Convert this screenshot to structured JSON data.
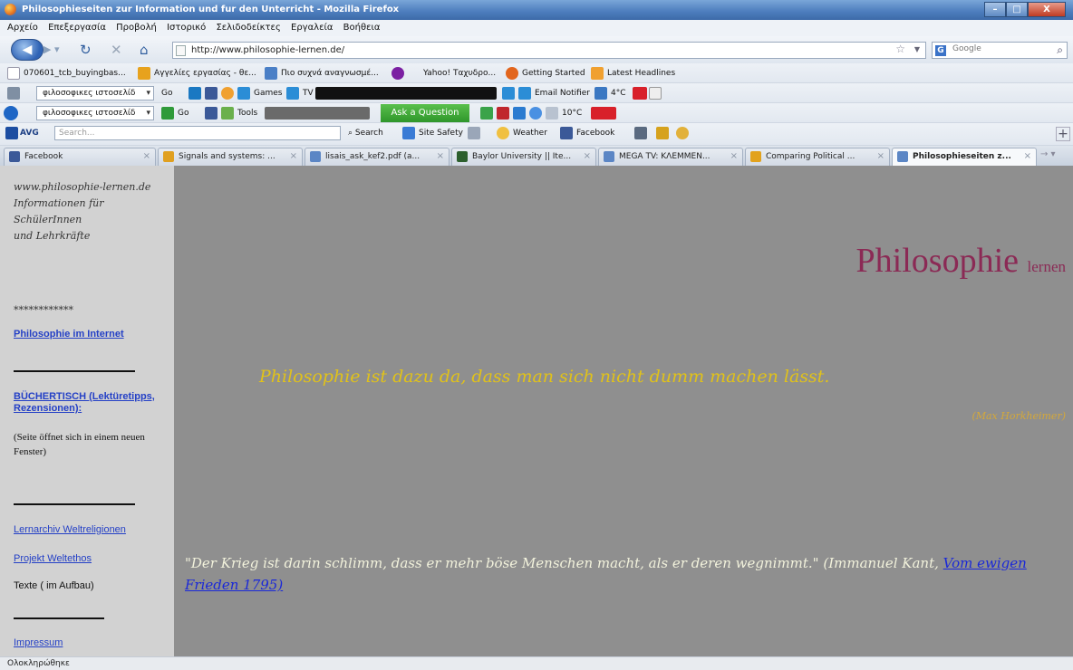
{
  "window": {
    "title": "Philosophieseiten zur Information und fur den Unterricht - Mozilla Firefox",
    "min": "–",
    "max": "□",
    "close": "X"
  },
  "menu": [
    "Αρχείο",
    "Επεξεργασία",
    "Προβολή",
    "Ιστορικό",
    "Σελιδοδείκτες",
    "Εργαλεία",
    "Βοήθεια"
  ],
  "nav": {
    "url": "http://www.philosophie-lernen.de/",
    "search_placeholder": "Google"
  },
  "bookmarks": {
    "items": [
      "070601_tcb_buyingbas...",
      "Αγγελίες εργασίας - θε...",
      "Πιο συχνά αναγνωσμέ...",
      "Yahoo! Ταχυδρο...",
      "Getting Started",
      "Latest Headlines"
    ]
  },
  "toolbar1": {
    "select": "φιλοσοφικες ιστοσελίδ",
    "go": "Go",
    "games": "Games",
    "tv": "TV",
    "email": "Email Notifier",
    "temp": "4°C"
  },
  "toolbar2": {
    "select": "φιλοσοφικες ιστοσελίδ",
    "go": "Go",
    "tools": "Tools",
    "ask": "Ask a Question",
    "temp": "10°C"
  },
  "avg": {
    "logo": "AVG",
    "placeholder": "Search...",
    "search": "Search",
    "safety": "Site Safety",
    "weather": "Weather",
    "facebook": "Facebook"
  },
  "tabs": [
    {
      "label": "Facebook",
      "color": "#3b5998"
    },
    {
      "label": "Signals and systems: ...",
      "color": "#e0a020"
    },
    {
      "label": "lisais_ask_kef2.pdf (a...",
      "color": "#5b86c5"
    },
    {
      "label": "Baylor University || Ite...",
      "color": "#2c5f2d"
    },
    {
      "label": "MEGA TV: ΚΛΕΜΜΕΝ...",
      "color": "#5b86c5"
    },
    {
      "label": "Comparing Political ...",
      "color": "#e2a21d"
    },
    {
      "label": "Philosophieseiten z...",
      "color": "#5b86c5",
      "active": true
    }
  ],
  "sidebar": {
    "lines": [
      "www.philosophie-lernen.de",
      "Informationen für",
      "SchülerInnen",
      "und Lehrkräfte"
    ],
    "stars": "************",
    "link_internet": "Philosophie im Internet",
    "link_buecher": "BÜCHERTISCH (Lektüretipps, Rezensionen):",
    "note": "(Seite öffnet sich in einem neuen Fenster)",
    "link_lernarchiv": "Lernarchiv Weltreligionen",
    "link_weltethos": "Projekt Weltethos",
    "texte": "Texte ( im Aufbau)",
    "link_impressum": "Impressum"
  },
  "content": {
    "title_main": "Philosophie",
    "title_small": "lernen",
    "quote1": "Philosophie ist dazu da, dass man sich nicht dumm machen lässt.",
    "attribution": "(Max Horkheimer)",
    "quote2": "\"Der Krieg ist darin schlimm, dass er mehr böse Menschen macht, als er deren wegnimmt.\" (Immanuel Kant,",
    "quote2_link": "Vom ewigen Frieden 1795)"
  },
  "status": "Ολοκληρώθηκε"
}
